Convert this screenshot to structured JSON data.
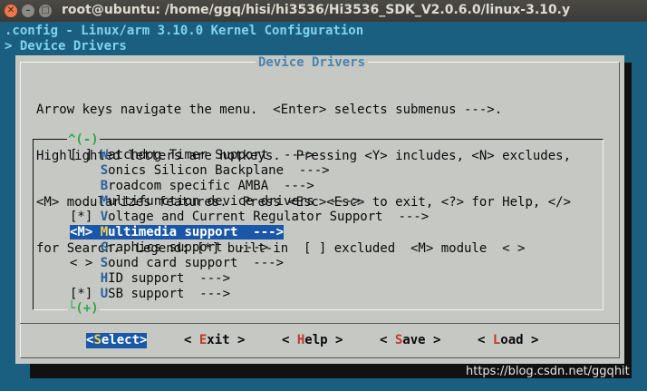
{
  "window": {
    "title": "root@ubuntu: /home/ggq/hisi/hi3536/Hi3536_SDK_V2.0.6.0/linux-3.10.y",
    "close_glyph": "✕",
    "min_glyph": "–",
    "max_glyph": "□"
  },
  "terminal": {
    "line1": ".config - Linux/arm 3.10.0 Kernel Configuration",
    "line2": "> Device Drivers"
  },
  "dialog": {
    "title": "Device Drivers",
    "help_lines": [
      "Arrow keys navigate the menu.  <Enter> selects submenus --->.",
      "Highlighted letters are hotkeys.  Pressing <Y> includes, <N> excludes,",
      "<M> modularizes features.  Press <Esc><Esc> to exit, <?> for Help, </>",
      "for Search.  Legend: [*] built-in  [ ] excluded  <M> module  < >"
    ],
    "scroll_up": "^(-)",
    "scroll_down": "└(+)",
    "items": [
      {
        "prefix": "[ ] ",
        "hotkey": "W",
        "rest": "atchdog Timer Support  --->"
      },
      {
        "prefix": "    ",
        "hotkey": "S",
        "rest": "onics Silicon Backplane  --->"
      },
      {
        "prefix": "    ",
        "hotkey": "B",
        "rest": "roadcom specific AMBA  --->"
      },
      {
        "prefix": "    ",
        "hotkey": "M",
        "rest": "ultifunction device drivers  --->"
      },
      {
        "prefix": "[*] ",
        "hotkey": "V",
        "rest": "oltage and Current Regulator Support  --->"
      },
      {
        "prefix": "<M> ",
        "hotkey": "M",
        "rest": "ultimedia support  --->"
      },
      {
        "prefix": "    ",
        "hotkey": "G",
        "rest": "raphics support  --->"
      },
      {
        "prefix": "< > ",
        "hotkey": "S",
        "rest": "ound card support  --->"
      },
      {
        "prefix": "    ",
        "hotkey": "H",
        "rest": "ID support  --->"
      },
      {
        "prefix": "[*] ",
        "hotkey": "U",
        "rest": "SB support  --->"
      }
    ],
    "selected_index": 5,
    "buttons": {
      "select": {
        "left": "<",
        "hotkey": "S",
        "rest": "elect",
        "right": ">"
      },
      "exit": {
        "left": "< ",
        "hotkey": "E",
        "rest": "xit",
        "right": " >"
      },
      "help": {
        "left": "< ",
        "hotkey": "H",
        "rest": "elp",
        "right": " >"
      },
      "save": {
        "left": "< ",
        "hotkey": "S",
        "rest": "ave",
        "right": " >"
      },
      "load": {
        "left": "< ",
        "hotkey": "L",
        "rest": "oad",
        "right": " >"
      }
    }
  },
  "watermark": "https://blog.csdn.net/ggqhit",
  "colors": {
    "terminal_bg": "#1b5f80",
    "dialog_bg": "#c6c8c3",
    "selection_bg": "#1a57a8",
    "hotkey": "#2a5f9e",
    "title_text": "#4a84b0"
  }
}
